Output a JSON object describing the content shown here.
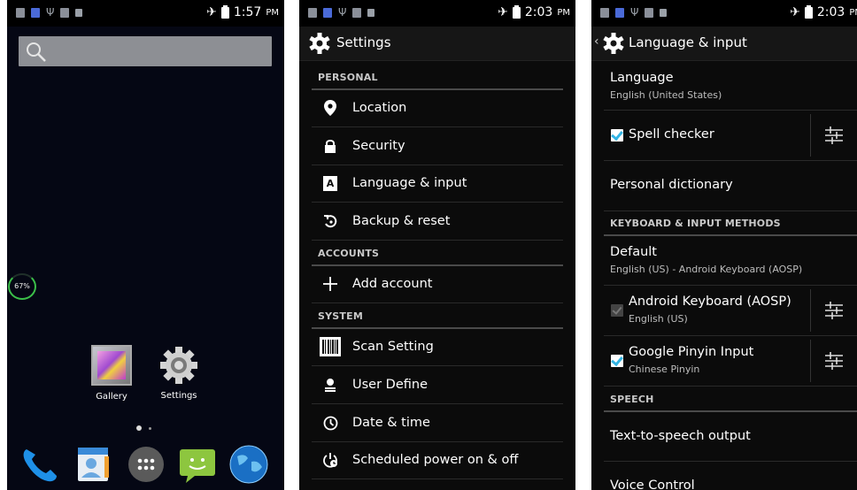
{
  "colors": {
    "accent": "#33b5e5",
    "home_bg": "#050714",
    "settings_bg": "#0b0b0b"
  },
  "screen1": {
    "status": {
      "time": "1:57",
      "ampm": "PM"
    },
    "battery_widget": "67%",
    "search_icon": "search-icon",
    "apps": [
      {
        "label": "Gallery",
        "icon": "gallery-icon"
      },
      {
        "label": "Settings",
        "icon": "gear-icon"
      }
    ],
    "dock": [
      "phone-icon",
      "contacts-icon",
      "app-drawer-icon",
      "messaging-icon",
      "browser-icon"
    ]
  },
  "screen2": {
    "status": {
      "time": "2:03",
      "ampm": "PM"
    },
    "title": "Settings",
    "sections": {
      "personal": "PERSONAL",
      "accounts": "ACCOUNTS",
      "system": "SYSTEM"
    },
    "personal_items": [
      "Location",
      "Security",
      "Language & input",
      "Backup & reset"
    ],
    "add_account": "Add account",
    "system_items": [
      "Scan Setting",
      "User Define",
      "Date & time",
      "Scheduled power on & off"
    ]
  },
  "screen3": {
    "status": {
      "time": "2:03",
      "ampm": "PM"
    },
    "title": "Language & input",
    "language": {
      "title": "Language",
      "value": "English (United States)"
    },
    "spell_checker": "Spell checker",
    "personal_dictionary": "Personal dictionary",
    "section_keyboard": "KEYBOARD & INPUT METHODS",
    "default": {
      "title": "Default",
      "value": "English (US) - Android Keyboard (AOSP)"
    },
    "android_keyboard": {
      "title": "Android Keyboard (AOSP)",
      "sub": "English (US)"
    },
    "pinyin": {
      "title": "Google Pinyin Input",
      "sub": "Chinese Pinyin"
    },
    "section_speech": "SPEECH",
    "tts": "Text-to-speech output",
    "voice_control": "Voice Control"
  }
}
